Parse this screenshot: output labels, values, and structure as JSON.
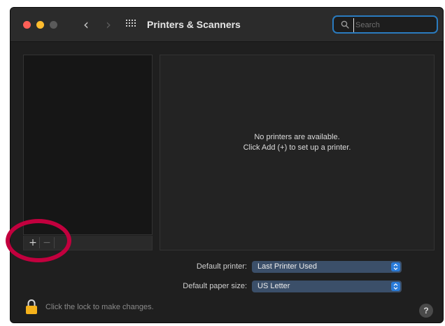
{
  "window": {
    "title": "Printers & Scanners"
  },
  "titlebar": {
    "back_icon": "chevron-left-icon",
    "forward_icon": "chevron-right-icon",
    "grid_icon": "grid-icon"
  },
  "search": {
    "placeholder": "Search",
    "value": ""
  },
  "list_toolbar": {
    "add_label": "+",
    "remove_label": "−"
  },
  "detail": {
    "empty_line1": "No printers are available.",
    "empty_line2": "Click Add (+) to set up a printer."
  },
  "settings": {
    "default_printer_label": "Default printer:",
    "default_printer_value": "Last Printer Used",
    "default_paper_label": "Default paper size:",
    "default_paper_value": "US Letter"
  },
  "footer": {
    "lock_text": "Click the lock to make changes.",
    "help_label": "?"
  },
  "colors": {
    "window_bg": "#1f1f1f",
    "accent": "#2a7bd8",
    "annotation": "#c2003e",
    "lock": "#f5b21b"
  }
}
